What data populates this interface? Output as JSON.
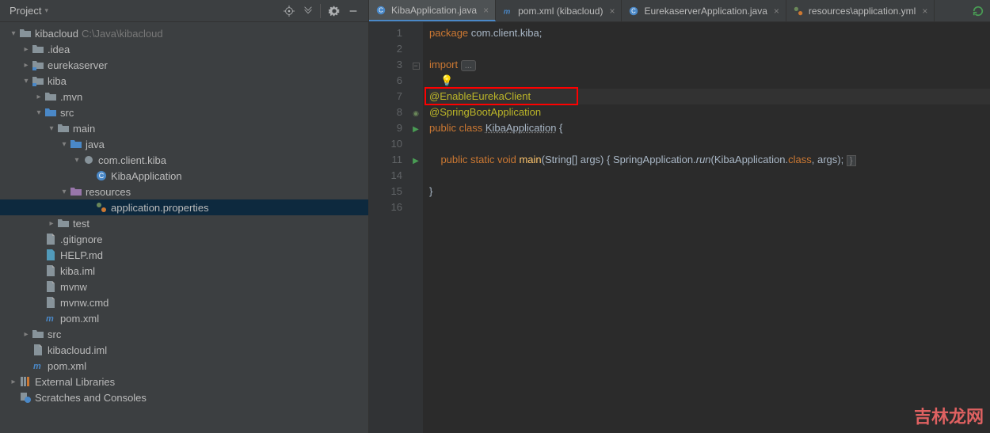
{
  "panel": {
    "title": "Project"
  },
  "tree": [
    {
      "depth": 0,
      "arrow": "down",
      "icon": "folder-root",
      "label": "kibacloud",
      "hint": "C:\\Java\\kibacloud"
    },
    {
      "depth": 1,
      "arrow": "right",
      "icon": "folder",
      "label": ".idea"
    },
    {
      "depth": 1,
      "arrow": "right",
      "icon": "module",
      "label": "eurekaserver"
    },
    {
      "depth": 1,
      "arrow": "down",
      "icon": "module",
      "label": "kiba"
    },
    {
      "depth": 2,
      "arrow": "right",
      "icon": "folder",
      "label": ".mvn"
    },
    {
      "depth": 2,
      "arrow": "down",
      "icon": "src-folder",
      "label": "src"
    },
    {
      "depth": 3,
      "arrow": "down",
      "icon": "folder",
      "label": "main"
    },
    {
      "depth": 4,
      "arrow": "down",
      "icon": "src-folder",
      "label": "java"
    },
    {
      "depth": 5,
      "arrow": "down",
      "icon": "package",
      "label": "com.client.kiba"
    },
    {
      "depth": 6,
      "arrow": "none",
      "icon": "java-class",
      "label": "KibaApplication"
    },
    {
      "depth": 4,
      "arrow": "down",
      "icon": "res-folder",
      "label": "resources"
    },
    {
      "depth": 6,
      "arrow": "none",
      "icon": "yml",
      "label": "application.properties",
      "selected": true
    },
    {
      "depth": 3,
      "arrow": "right",
      "icon": "folder",
      "label": "test"
    },
    {
      "depth": 2,
      "arrow": "none",
      "icon": "file",
      "label": ".gitignore"
    },
    {
      "depth": 2,
      "arrow": "none",
      "icon": "md",
      "label": "HELP.md"
    },
    {
      "depth": 2,
      "arrow": "none",
      "icon": "file",
      "label": "kiba.iml"
    },
    {
      "depth": 2,
      "arrow": "none",
      "icon": "file",
      "label": "mvnw"
    },
    {
      "depth": 2,
      "arrow": "none",
      "icon": "file",
      "label": "mvnw.cmd"
    },
    {
      "depth": 2,
      "arrow": "none",
      "icon": "maven",
      "label": "pom.xml"
    },
    {
      "depth": 1,
      "arrow": "right",
      "icon": "folder",
      "label": "src"
    },
    {
      "depth": 1,
      "arrow": "none",
      "icon": "file",
      "label": "kibacloud.iml"
    },
    {
      "depth": 1,
      "arrow": "none",
      "icon": "maven",
      "label": "pom.xml"
    },
    {
      "depth": 0,
      "arrow": "right",
      "icon": "library",
      "label": "External Libraries"
    },
    {
      "depth": 0,
      "arrow": "none",
      "icon": "scratch",
      "label": "Scratches and Consoles"
    }
  ],
  "tabs": [
    {
      "icon": "java-class",
      "label": "KibaApplication.java",
      "active": true
    },
    {
      "icon": "maven",
      "label": "pom.xml (kibacloud)"
    },
    {
      "icon": "java-class",
      "label": "EurekaserverApplication.java"
    },
    {
      "icon": "yml",
      "label": "resources\\application.yml"
    }
  ],
  "gutter": [
    "1",
    "2",
    "3",
    "6",
    "7",
    "8",
    "9",
    "10",
    "11",
    "14",
    "15",
    "16"
  ],
  "code": {
    "package": "package ",
    "packageName": "com.client.kiba;",
    "import": "import ",
    "fold": "...",
    "ann1": "@EnableEurekaClient",
    "ann2": "@SpringBootApplication",
    "pubclass": "public class ",
    "className": "KibaApplication",
    "brace": " {",
    "main_public": "public static void ",
    "main_name": "main",
    "main_args": "(String[] args) { ",
    "spring": "SpringApplication.",
    "run": "run",
    "runargs": "(KibaApplication.",
    "classkw": "class",
    "runend": ", args); ",
    "closeBrace": "}",
    "boxend": "}"
  },
  "watermark": "吉林龙网"
}
